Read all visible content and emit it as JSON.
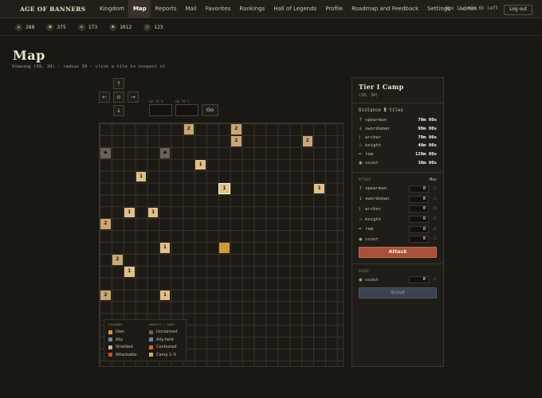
{
  "brand": "AGE OF BANNERS",
  "nav": [
    "Kingdom",
    "Map",
    "Reports",
    "Mail",
    "Favorites",
    "Rankings",
    "Hall of Legends",
    "Profile",
    "Roadmap and Feedback",
    "Settings",
    "Admin"
  ],
  "active_nav": "Map",
  "age_status": "Age 1 — 41d 6h left",
  "logout_label": "Log out",
  "resources": [
    {
      "icon": "flag-icon",
      "glyph": "▲",
      "value": "288"
    },
    {
      "icon": "wood-icon",
      "glyph": "■",
      "value": "375"
    },
    {
      "icon": "stone-icon",
      "glyph": "◆",
      "value": "173"
    },
    {
      "icon": "gold-icon",
      "glyph": "●",
      "value": "1012"
    },
    {
      "icon": "population-icon",
      "glyph": "◎",
      "value": "123"
    }
  ],
  "page": {
    "title": "Map",
    "viewing": "Viewing (39, 39) · radius 10 · click a tile to inspect it"
  },
  "controls": {
    "up": "↑",
    "left": "←",
    "center": "⊙",
    "right": "→",
    "down": "↓",
    "go_x_label": "GO TO X",
    "go_y_label": "GO TO Y",
    "go_label": "Go"
  },
  "tiles": [
    {
      "col": 7,
      "row": 0,
      "label": "2",
      "kind": "camp2"
    },
    {
      "col": 11,
      "row": 0,
      "label": "2",
      "kind": "camp2"
    },
    {
      "col": 11,
      "row": 1,
      "label": "2",
      "kind": "camp2"
    },
    {
      "col": 17,
      "row": 1,
      "label": "2",
      "kind": "camp2"
    },
    {
      "col": 0,
      "row": 2,
      "label": "◆",
      "kind": "dark"
    },
    {
      "col": 5,
      "row": 2,
      "label": "◆",
      "kind": "dark"
    },
    {
      "col": 8,
      "row": 3,
      "label": "1",
      "kind": "camp1"
    },
    {
      "col": 3,
      "row": 4,
      "label": "1",
      "kind": "camp1"
    },
    {
      "col": 10,
      "row": 5,
      "label": "1",
      "kind": "camp1",
      "selected": true
    },
    {
      "col": 18,
      "row": 5,
      "label": "1",
      "kind": "camp1"
    },
    {
      "col": 2,
      "row": 7,
      "label": "1",
      "kind": "camp1"
    },
    {
      "col": 4,
      "row": 7,
      "label": "1",
      "kind": "camp1"
    },
    {
      "col": 0,
      "row": 8,
      "label": "2",
      "kind": "camp2"
    },
    {
      "col": 5,
      "row": 10,
      "label": "1",
      "kind": "camp1"
    },
    {
      "col": 10,
      "row": 10,
      "label": "",
      "kind": "own"
    },
    {
      "col": 1,
      "row": 11,
      "label": "2",
      "kind": "camp2"
    },
    {
      "col": 2,
      "row": 12,
      "label": "1",
      "kind": "camp1"
    },
    {
      "col": 0,
      "row": 14,
      "label": "2",
      "kind": "camp2"
    },
    {
      "col": 5,
      "row": 14,
      "label": "1",
      "kind": "camp1"
    }
  ],
  "legend": {
    "kingdoms_title": "KINGDOMS",
    "camps_title": "HAMLETS / CAMPS",
    "kingdoms": [
      {
        "label": "Own",
        "color": "#d19a3c"
      },
      {
        "label": "Ally",
        "color": "#6b87b5"
      },
      {
        "label": "Shielded",
        "color": "#c9b68f"
      },
      {
        "label": "Attackable",
        "color": "#b5533c"
      }
    ],
    "camps": [
      {
        "label": "Unclaimed",
        "color": "#6a6156"
      },
      {
        "label": "Ally-held",
        "color": "#6b87b5"
      },
      {
        "label": "Contested",
        "color": "#c86b3a"
      },
      {
        "label": "Camp 1–5",
        "color": "#c8a778"
      }
    ]
  },
  "panel": {
    "title": "Tier I Camp",
    "coords": "(39, 34)",
    "distance_label": "Distance",
    "distance_value": "5",
    "distance_unit": "tiles",
    "travel": [
      {
        "icon": "spear-icon",
        "glyph": "↑",
        "name": "spearman",
        "time": "70m 00s"
      },
      {
        "icon": "sword-icon",
        "glyph": "↓",
        "name": "swordsman",
        "time": "90m 00s"
      },
      {
        "icon": "bow-icon",
        "glyph": "⟩",
        "name": "archer",
        "time": "70m 00s"
      },
      {
        "icon": "knight-icon",
        "glyph": "♘",
        "name": "knight",
        "time": "40m 00s"
      },
      {
        "icon": "ram-icon",
        "glyph": "━",
        "name": "ram",
        "time": "120m 00s"
      },
      {
        "icon": "eye-icon",
        "glyph": "◉",
        "name": "scout",
        "time": "30m 00s"
      }
    ],
    "attack_title": "ATTACK",
    "max_label": "Max",
    "attack_units": [
      {
        "icon": "spear-icon",
        "glyph": "↑",
        "name": "spearman",
        "value": "0",
        "max": "/1"
      },
      {
        "icon": "sword-icon",
        "glyph": "↓",
        "name": "swordsman",
        "value": "0",
        "max": "/2"
      },
      {
        "icon": "bow-icon",
        "glyph": "⟩",
        "name": "archer",
        "value": "0",
        "max": "/0"
      },
      {
        "icon": "knight-icon",
        "glyph": "♘",
        "name": "knight",
        "value": "0",
        "max": "/1"
      },
      {
        "icon": "ram-icon",
        "glyph": "━",
        "name": "ram",
        "value": "0",
        "max": "/0"
      },
      {
        "icon": "eye-icon",
        "glyph": "◉",
        "name": "scout",
        "value": "0",
        "max": "/1"
      }
    ],
    "attack_button": "Attack",
    "scout_title": "SCOUT",
    "scout_unit": {
      "icon": "eye-icon",
      "glyph": "◉",
      "name": "scout",
      "value": "0",
      "max": "/1"
    },
    "scout_button": "Scout"
  }
}
